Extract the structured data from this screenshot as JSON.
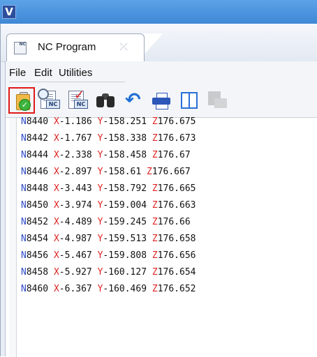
{
  "app": {
    "logo_glyph": "V"
  },
  "tab": {
    "label": "NC Program",
    "icon_text": "NC",
    "close_glyph": "⤫"
  },
  "menu": [
    "File",
    "Edit",
    "Utilities"
  ],
  "toolbar": {
    "buttons": [
      {
        "name": "verify-clipboard",
        "icon": "clipboard-check-icon",
        "selected": true
      },
      {
        "name": "search-nc",
        "icon": "search-nc-icon",
        "badge": "NC"
      },
      {
        "name": "check-nc",
        "icon": "check-nc-icon",
        "badge": "NC"
      },
      {
        "name": "find",
        "icon": "binoculars-icon"
      },
      {
        "name": "undo",
        "icon": "undo-icon"
      },
      {
        "name": "print",
        "icon": "printer-icon"
      },
      {
        "name": "split-view",
        "icon": "split-view-icon"
      },
      {
        "name": "nc-disabled",
        "icon": "nc-disabled-icon",
        "disabled": true
      }
    ],
    "selected_border_color": "#e01818"
  },
  "colors": {
    "address_letter": "#2f4cc7",
    "axis_letter": "#e02222"
  },
  "code_lines": [
    {
      "n": "8440",
      "x": "-1.186",
      "y": "-158.251",
      "z": "176.675"
    },
    {
      "n": "8442",
      "x": "-1.767",
      "y": "-158.338",
      "z": "176.673"
    },
    {
      "n": "8444",
      "x": "-2.338",
      "y": "-158.458",
      "z": "176.67"
    },
    {
      "n": "8446",
      "x": "-2.897",
      "y": "-158.61",
      "z": "176.667"
    },
    {
      "n": "8448",
      "x": "-3.443",
      "y": "-158.792",
      "z": "176.665"
    },
    {
      "n": "8450",
      "x": "-3.974",
      "y": "-159.004",
      "z": "176.663"
    },
    {
      "n": "8452",
      "x": "-4.489",
      "y": "-159.245",
      "z": "176.66"
    },
    {
      "n": "8454",
      "x": "-4.987",
      "y": "-159.513",
      "z": "176.658"
    },
    {
      "n": "8456",
      "x": "-5.467",
      "y": "-159.808",
      "z": "176.656"
    },
    {
      "n": "8458",
      "x": "-5.927",
      "y": "-160.127",
      "z": "176.654"
    },
    {
      "n": "8460",
      "x": "-6.367",
      "y": "-160.469",
      "z": "176.652"
    }
  ]
}
